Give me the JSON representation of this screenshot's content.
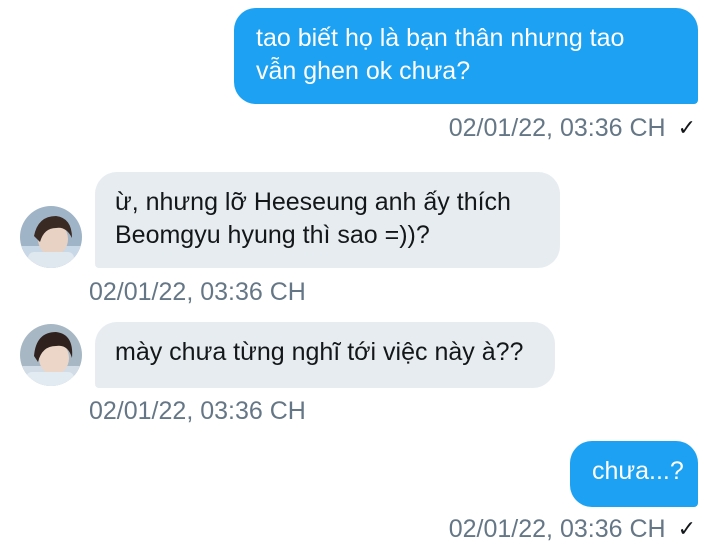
{
  "messages": [
    {
      "direction": "outgoing",
      "text": "tao biết họ là bạn thân nhưng tao\nvẫn ghen ok chưa?",
      "time": "02/01/22, 03:36 CH",
      "read_icon": "check-icon"
    },
    {
      "direction": "incoming",
      "text": "ừ, nhưng lỡ Heeseung anh ấy thích\nBeomgyu hyung thì sao =))?",
      "time": "02/01/22, 03:36 CH",
      "avatar": "avatar-icon"
    },
    {
      "direction": "incoming",
      "text": "mày chưa từng nghĩ tới việc này à??",
      "time": "02/01/22, 03:36 CH",
      "avatar": "avatar-icon"
    },
    {
      "direction": "outgoing",
      "text": "chưa...?",
      "time": "02/01/22, 03:36 CH",
      "read_icon": "check-icon"
    }
  ],
  "colors": {
    "outgoing_bubble": "#1da1f2",
    "incoming_bubble": "#e6ecf0",
    "timestamp": "#657786"
  }
}
